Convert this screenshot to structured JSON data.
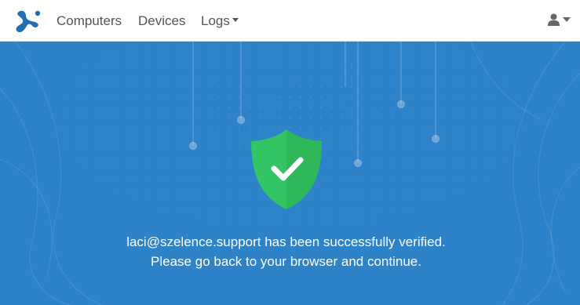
{
  "navbar": {
    "brand_icon": "splashtop-logo-icon",
    "links": [
      {
        "label": "Computers"
      },
      {
        "label": "Devices"
      },
      {
        "label": "Logs",
        "dropdown": true
      }
    ],
    "user_menu_icon": "user-icon"
  },
  "verification": {
    "icon": "shield-check-icon",
    "message_line1": "laci@szelence.support has been successfully verified.",
    "message_line2": "Please go back to your browser and continue."
  },
  "colors": {
    "brand_blue": "#1f6fb5",
    "hero_background": "#2d82c8",
    "shield_green": "#33c463",
    "nav_text": "#555555"
  }
}
